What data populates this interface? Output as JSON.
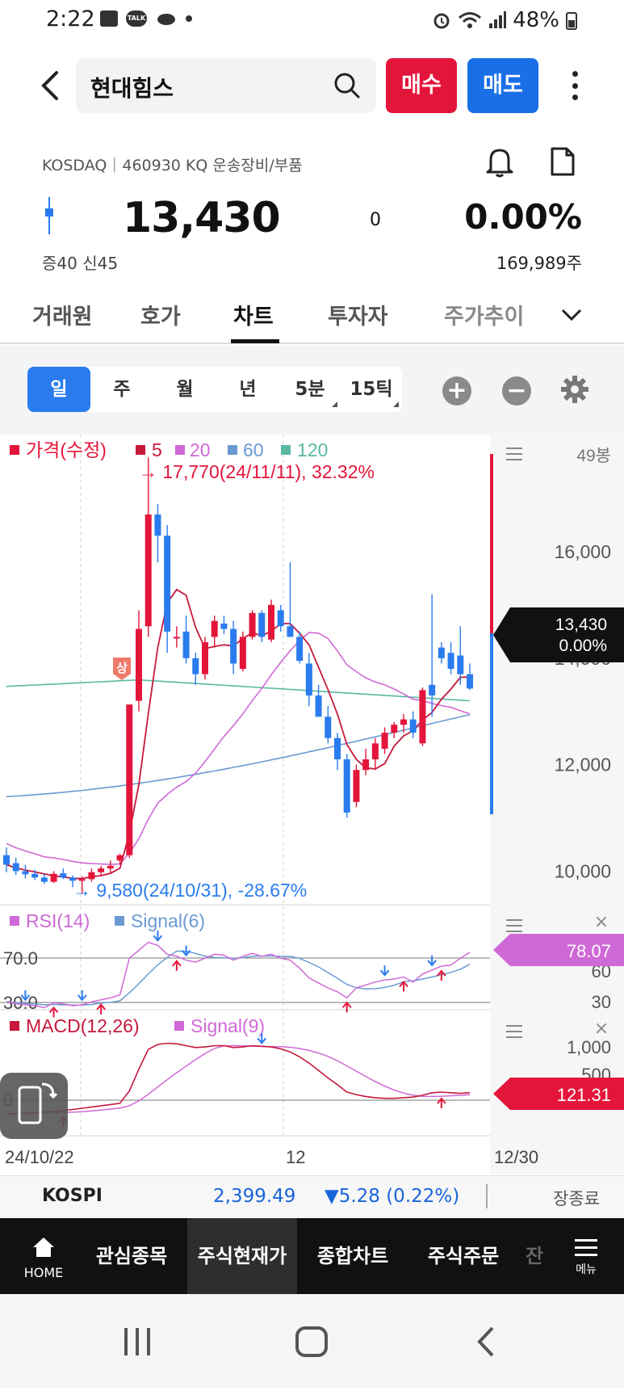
{
  "status": {
    "time": "2:22",
    "battery": "48%"
  },
  "header": {
    "stock_name": "현대힘스",
    "buy_label": "매수",
    "sell_label": "매도"
  },
  "quote": {
    "market_info": "KOSDAQ｜460930 KQ 운송장비/부품",
    "price": "13,430",
    "change": "0",
    "change_rate": "0.00%",
    "margin_info": "증40  신45",
    "volume": "169,989주"
  },
  "tabs": [
    "거래원",
    "호가",
    "차트",
    "투자자",
    "주가추이"
  ],
  "periods": [
    "일",
    "주",
    "월",
    "년",
    "5분",
    "15틱"
  ],
  "chart_data": {
    "type": "candlestick",
    "legend": {
      "price": "가격(수정)",
      "ma": [
        "5",
        "20",
        "60",
        "120"
      ]
    },
    "bar_count_label": "49봉",
    "high_annotation": "17,770(24/11/11), 32.32%",
    "low_annotation": "9,580(24/10/31), -28.67%",
    "upper_limit_badge": "상",
    "y_ticks": [
      "16,000",
      "14,000",
      "12,000",
      "10,000"
    ],
    "ylim": [
      9400,
      18200
    ],
    "current_tag": {
      "price": "13,430",
      "rate": "0.00%"
    },
    "x_labels": [
      "24/10/22",
      "12",
      "12/30"
    ],
    "candles": [
      [
        10300,
        10450,
        9980,
        10120
      ],
      [
        10150,
        10250,
        9930,
        10000
      ],
      [
        10000,
        10120,
        9860,
        9940
      ],
      [
        9950,
        10030,
        9830,
        9880
      ],
      [
        9880,
        9950,
        9760,
        9800
      ],
      [
        9800,
        10000,
        9780,
        9950
      ],
      [
        9960,
        10050,
        9850,
        9880
      ],
      [
        9880,
        9920,
        9700,
        9820
      ],
      [
        9820,
        9900,
        9580,
        9850
      ],
      [
        9850,
        10050,
        9800,
        9980
      ],
      [
        9980,
        10100,
        9900,
        10050
      ],
      [
        10050,
        10200,
        9950,
        10100
      ],
      [
        10200,
        10330,
        10120,
        10300
      ],
      [
        10300,
        13130,
        10250,
        13130
      ],
      [
        13200,
        14900,
        13000,
        14550
      ],
      [
        14600,
        17770,
        14400,
        16700
      ],
      [
        16700,
        16900,
        15800,
        16300
      ],
      [
        16300,
        16500,
        14100,
        14500
      ],
      [
        14400,
        14600,
        14200,
        14400
      ],
      [
        14500,
        14800,
        13900,
        14000
      ],
      [
        14000,
        14100,
        13500,
        13700
      ],
      [
        13700,
        14400,
        13600,
        14300
      ],
      [
        14400,
        14800,
        14200,
        14700
      ],
      [
        14650,
        14800,
        14450,
        14550
      ],
      [
        14550,
        14700,
        13700,
        13900
      ],
      [
        13800,
        14500,
        13750,
        14400
      ],
      [
        14400,
        14900,
        14350,
        14850
      ],
      [
        14850,
        14900,
        14300,
        14400
      ],
      [
        14350,
        15100,
        14300,
        15000
      ],
      [
        14900,
        15000,
        14500,
        14600
      ],
      [
        14600,
        15800,
        14400,
        14400
      ],
      [
        14400,
        14500,
        13900,
        13950
      ],
      [
        13900,
        14100,
        13100,
        13300
      ],
      [
        13300,
        13500,
        12900,
        12900
      ],
      [
        12900,
        13100,
        12400,
        12500
      ],
      [
        12500,
        12600,
        11900,
        12100
      ],
      [
        12100,
        12200,
        11000,
        11100
      ],
      [
        11300,
        12000,
        11200,
        11900
      ],
      [
        11900,
        12300,
        11800,
        12100
      ],
      [
        12100,
        12500,
        11900,
        12400
      ],
      [
        12300,
        12700,
        12200,
        12600
      ],
      [
        12600,
        12800,
        12500,
        12750
      ],
      [
        12750,
        12950,
        12600,
        12850
      ],
      [
        12850,
        13000,
        12500,
        12600
      ],
      [
        12400,
        13450,
        12350,
        13400
      ],
      [
        13500,
        15200,
        12900,
        13300
      ],
      [
        14200,
        14300,
        13900,
        14000
      ],
      [
        14100,
        14300,
        13700,
        13800
      ],
      [
        14050,
        14600,
        13500,
        13700
      ],
      [
        13700,
        13900,
        13400,
        13430
      ]
    ],
    "rsi": {
      "label": "RSI(14)",
      "signal_label": "Signal(6)",
      "value": "78.07",
      "ticks": [
        "70.0",
        "30.0"
      ],
      "right_ticks": [
        "60",
        "30"
      ]
    },
    "macd": {
      "label": "MACD(12,26)",
      "signal_label": "Signal(9)",
      "value": "121.31",
      "ticks": [
        "1,000",
        "500"
      ],
      "zero_label": "0"
    },
    "colors": {
      "up": "#e4153b",
      "down": "#2a7cee",
      "ma5": "#c6183c",
      "ma20": "#cf69d6",
      "ma60": "#6b9ad3",
      "ma120": "#5bb9a3"
    }
  },
  "kospi": {
    "label": "KOSPI",
    "value": "2,399.49",
    "change": "▼5.28 (0.22%)",
    "state": "장종료"
  },
  "bottom_nav": {
    "home": "HOME",
    "items": [
      "관심종목",
      "주식현재가",
      "종합차트",
      "주식주문",
      "잔"
    ],
    "menu": "메뉴"
  }
}
